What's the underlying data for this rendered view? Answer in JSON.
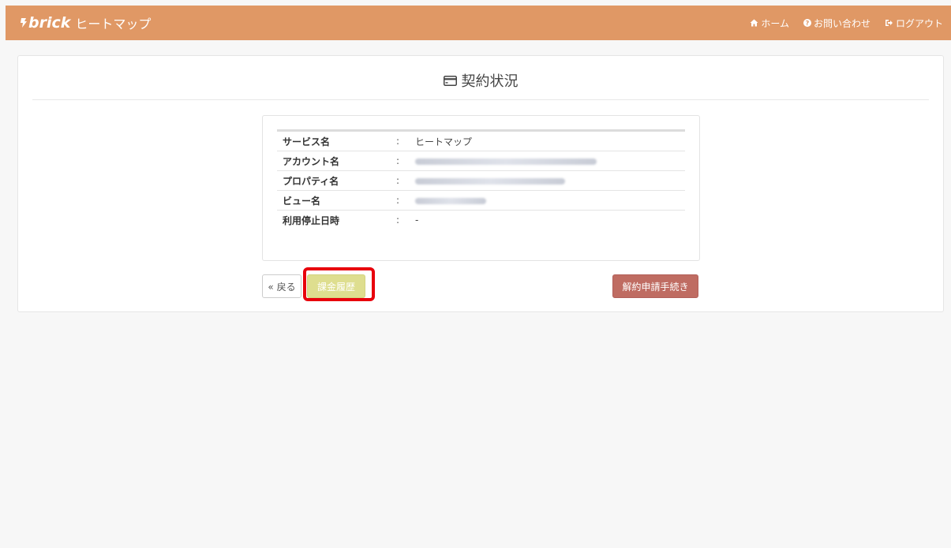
{
  "header": {
    "logo_text": "brick",
    "app_name": "ヒートマップ",
    "nav": [
      {
        "icon": "home-icon",
        "label": "ホーム"
      },
      {
        "icon": "question-circle-icon",
        "label": "お問い合わせ"
      },
      {
        "icon": "sign-out-icon",
        "label": "ログアウト"
      }
    ],
    "bg_color": "#e09865"
  },
  "page": {
    "title_icon": "credit-card-icon",
    "title": "契約状況"
  },
  "info": {
    "rows": [
      {
        "label": "サービス名",
        "colon": ":",
        "value": "ヒートマップ"
      },
      {
        "label": "アカウント名",
        "colon": ":",
        "value": ""
      },
      {
        "label": "プロパティ名",
        "colon": ":",
        "value": ""
      },
      {
        "label": "ビュー名",
        "colon": ":",
        "value": ""
      },
      {
        "label": "利用停止日時",
        "colon": ":",
        "value": "-"
      }
    ]
  },
  "buttons": {
    "back": "« 戻る",
    "billing_history": "課金履歴",
    "cancel_contract": "解約申請手続き"
  },
  "colors": {
    "billing_button": "#dede8f",
    "cancel_button": "#bf6c62",
    "highlight": "#e8000c"
  }
}
